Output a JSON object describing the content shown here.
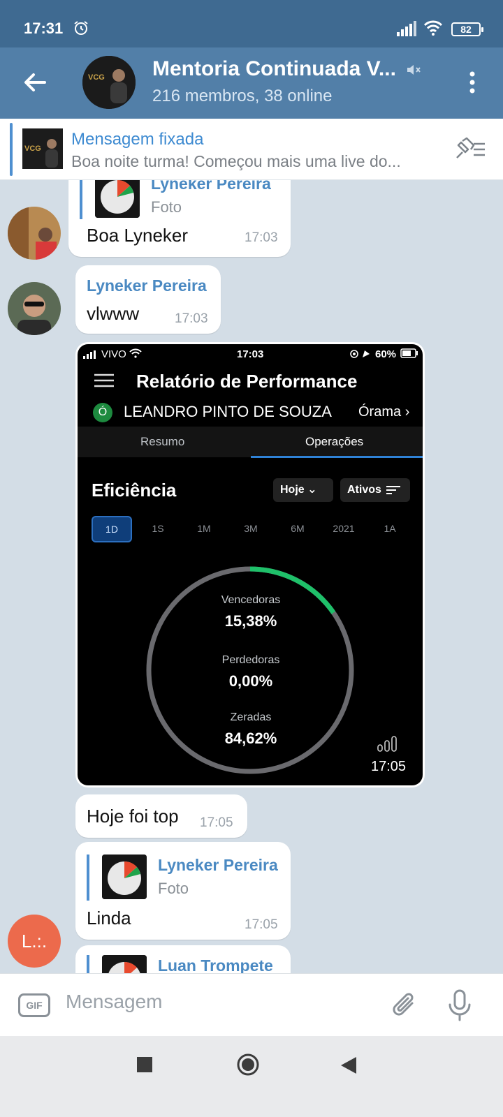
{
  "status_bar": {
    "time": "17:31",
    "battery": "82"
  },
  "header": {
    "title": "Mentoria Continuada V...",
    "subtitle": "216 membros, 38 online"
  },
  "pinned": {
    "title": "Mensagem fixada",
    "text": "Boa noite turma!  Começou mais uma live do..."
  },
  "messages": [
    {
      "reply_name": "Lyneker Pereira",
      "reply_type": "Foto",
      "text": "Boa Lyneker",
      "time": "17:03"
    },
    {
      "sender": "Lyneker Pereira",
      "text": "vlwww",
      "time": "17:03"
    },
    {
      "text": "Hoje foi top",
      "time": "17:05"
    },
    {
      "reply_name": "Lyneker Pereira",
      "reply_type": "Foto",
      "text": "Linda",
      "time": "17:05"
    },
    {
      "reply_name": "Luan Trompete"
    }
  ],
  "photo": {
    "carrier": "VIVO",
    "time": "17:03",
    "battery": "60%",
    "title": "Relatório de Performance",
    "account_name": "LEANDRO PINTO DE SOUZA",
    "broker": "Órama",
    "broker_logo": "Ó",
    "tabs": [
      "Resumo",
      "Operações"
    ],
    "heading": "Eficiência",
    "filter_period": "Hoje",
    "filter_assets": "Ativos",
    "ranges": [
      "1D",
      "1S",
      "1M",
      "3M",
      "6M",
      "2021",
      "1A"
    ],
    "stats": [
      {
        "label": "Vencedoras",
        "value": "15,38%"
      },
      {
        "label": "Perdedoras",
        "value": "0,00%"
      },
      {
        "label": "Zeradas",
        "value": "84,62%"
      }
    ],
    "ring_win_fraction": 0.1538,
    "colors": {
      "win": "#1fc06a",
      "neutral": "#6a6a6e"
    },
    "message_time": "17:05"
  },
  "fab": {
    "label": "L.:."
  },
  "input": {
    "placeholder": "Mensagem",
    "gif": "GIF"
  }
}
